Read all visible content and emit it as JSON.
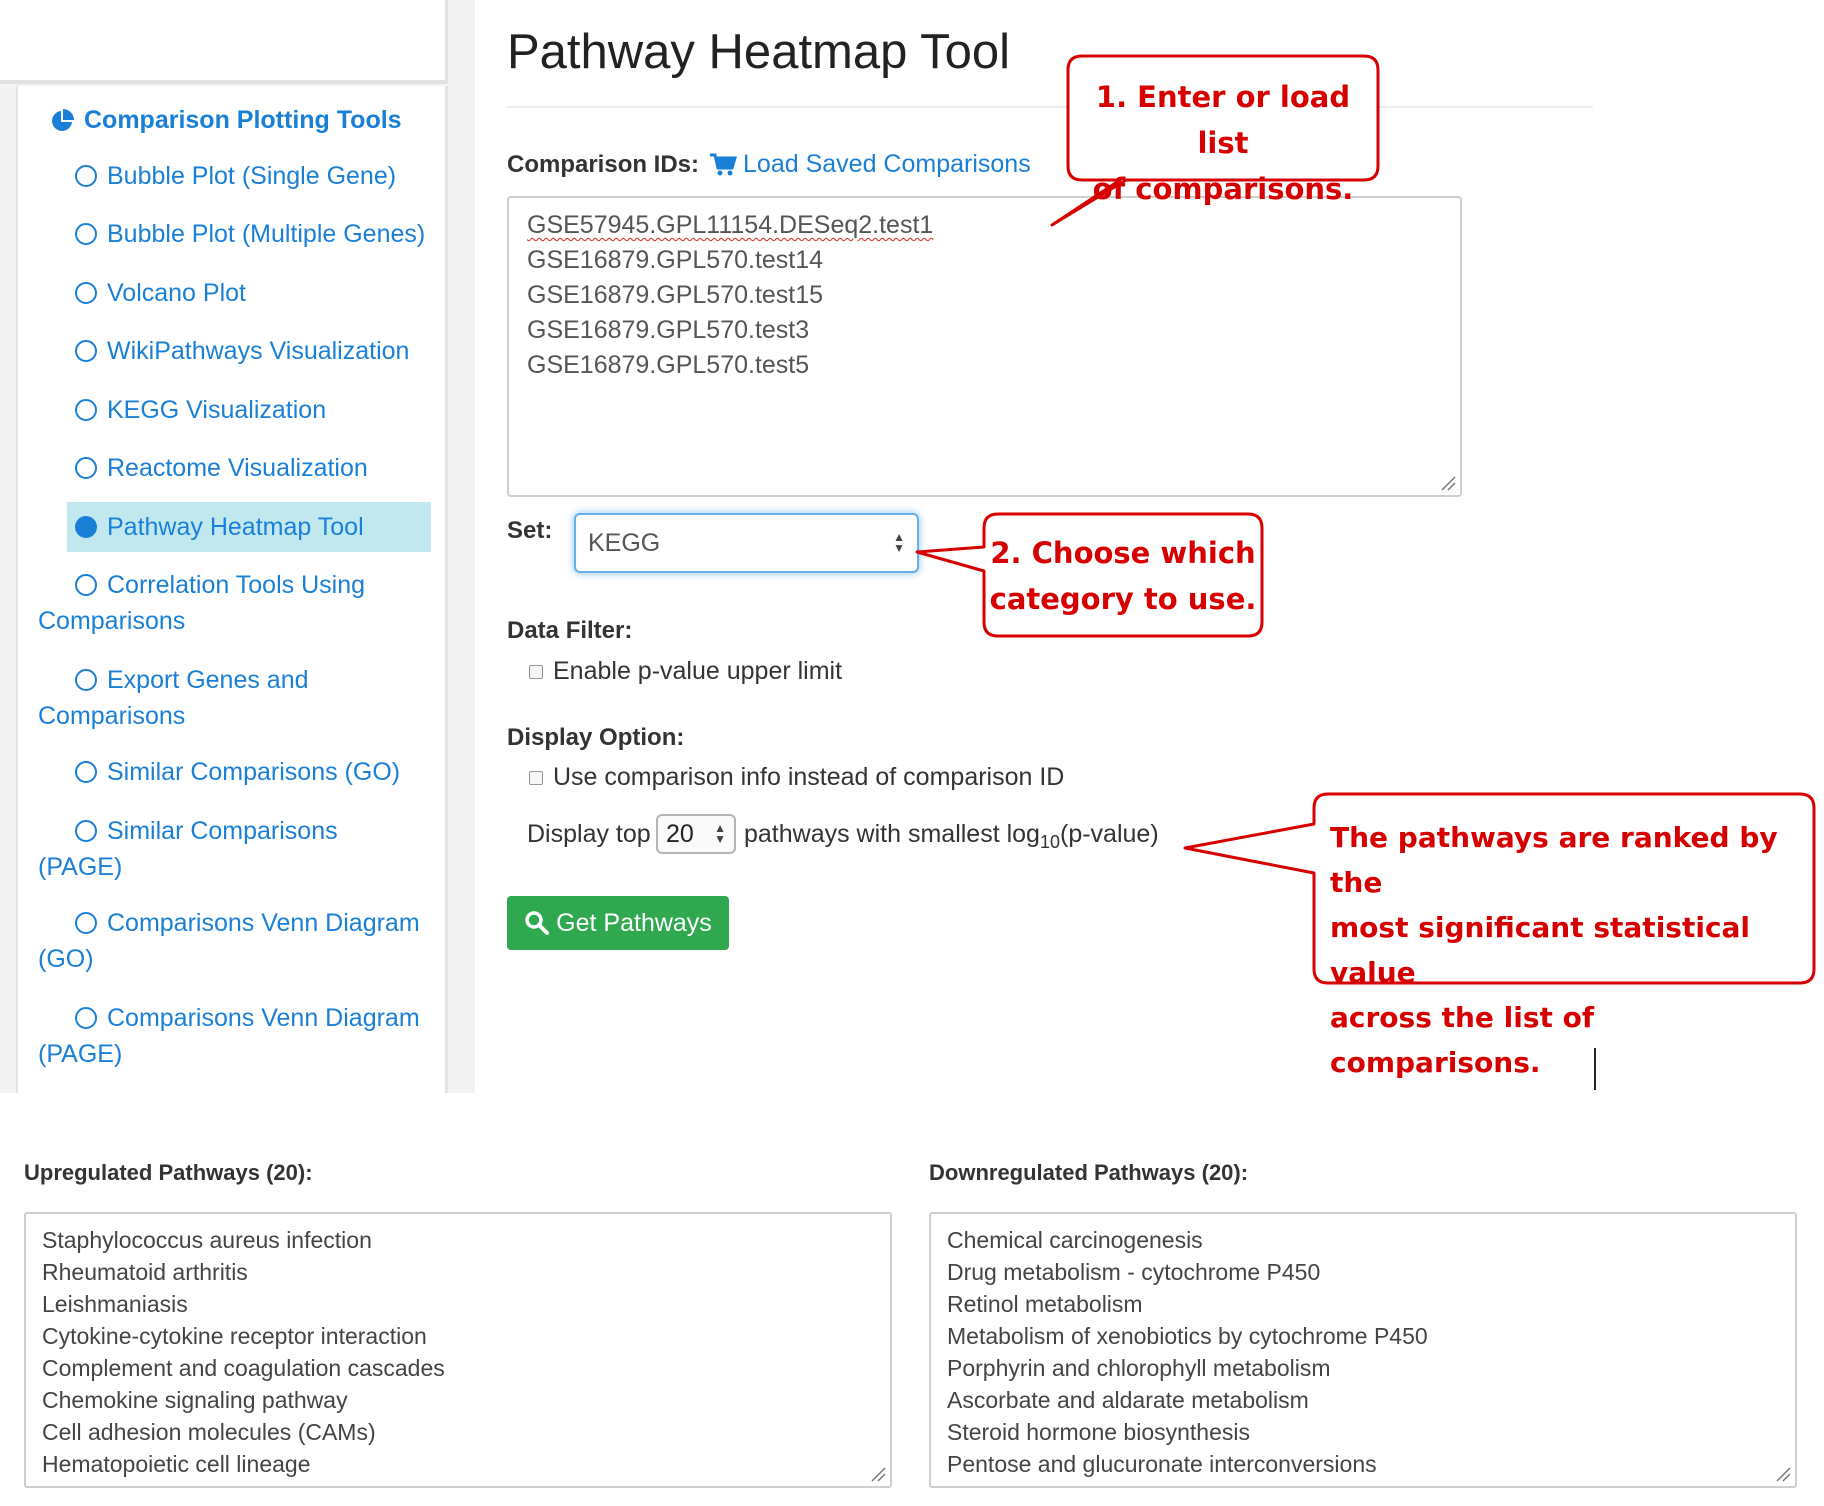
{
  "sidebar": {
    "header": "Comparison Plotting Tools",
    "items": [
      {
        "label": "Bubble Plot (Single Gene)"
      },
      {
        "label": "Bubble Plot (Multiple Genes)"
      },
      {
        "label": "Volcano Plot"
      },
      {
        "label": "WikiPathways Visualization"
      },
      {
        "label": "KEGG Visualization"
      },
      {
        "label": "Reactome Visualization"
      },
      {
        "label": "Pathway Heatmap Tool",
        "active": true
      },
      {
        "label": "Correlation Tools Using",
        "label2": "Comparisons"
      },
      {
        "label": "Export Genes and",
        "label2": "Comparisons"
      },
      {
        "label": "Similar Comparisons (GO)"
      },
      {
        "label": "Similar Comparisons",
        "label2": "(PAGE)"
      },
      {
        "label": "Comparisons Venn Diagram",
        "label2": "(GO)"
      },
      {
        "label": "Comparisons Venn Diagram",
        "label2": "(PAGE)"
      }
    ]
  },
  "main": {
    "title": "Pathway Heatmap Tool",
    "comparison_ids_label": "Comparison IDs:",
    "load_saved_label": "Load Saved Comparisons",
    "comparison_ids": [
      "GSE57945.GPL11154.DESeq2.test1",
      "GSE16879.GPL570.test14",
      "GSE16879.GPL570.test15",
      "GSE16879.GPL570.test3",
      "GSE16879.GPL570.test5"
    ],
    "set_label": "Set:",
    "set_value": "KEGG",
    "data_filter_label": "Data Filter:",
    "pvalue_checkbox_label": "Enable p-value upper limit",
    "display_option_label": "Display Option:",
    "use_info_checkbox_label": "Use comparison info instead of comparison ID",
    "display_top_prefix": "Display top",
    "display_top_value": "20",
    "display_top_suffix": "pathways with smallest log",
    "display_top_sub": "10",
    "display_top_tail": "(p-value)",
    "get_pathways_label": "Get Pathways"
  },
  "callouts": {
    "c1_line1": "1. Enter or load list",
    "c1_line2": "of comparisons.",
    "c2_line1": "2. Choose which",
    "c2_line2": "category to use.",
    "c3_line1": "The pathways are ranked by the",
    "c3_line2": "most significant statistical value",
    "c3_line3": "across the list of comparisons."
  },
  "results": {
    "up_label": "Upregulated Pathways (20):",
    "up_items": [
      "Staphylococcus aureus infection",
      "Rheumatoid arthritis",
      "Leishmaniasis",
      "Cytokine-cytokine receptor interaction",
      "Complement and coagulation cascades",
      "Chemokine signaling pathway",
      "Cell adhesion molecules (CAMs)",
      "Hematopoietic cell lineage"
    ],
    "down_label": "Downregulated Pathways (20):",
    "down_items": [
      "Chemical carcinogenesis",
      "Drug metabolism - cytochrome P450",
      "Retinol metabolism",
      "Metabolism of xenobiotics by cytochrome P450",
      "Porphyrin and chlorophyll metabolism",
      "Ascorbate and aldarate metabolism",
      "Steroid hormone biosynthesis",
      "Pentose and glucuronate interconversions"
    ]
  },
  "colors": {
    "link_blue": "#1a7fd6",
    "active_bg": "#c2e8ef",
    "button_green": "#2fa84f",
    "callout_red": "#d60000"
  }
}
